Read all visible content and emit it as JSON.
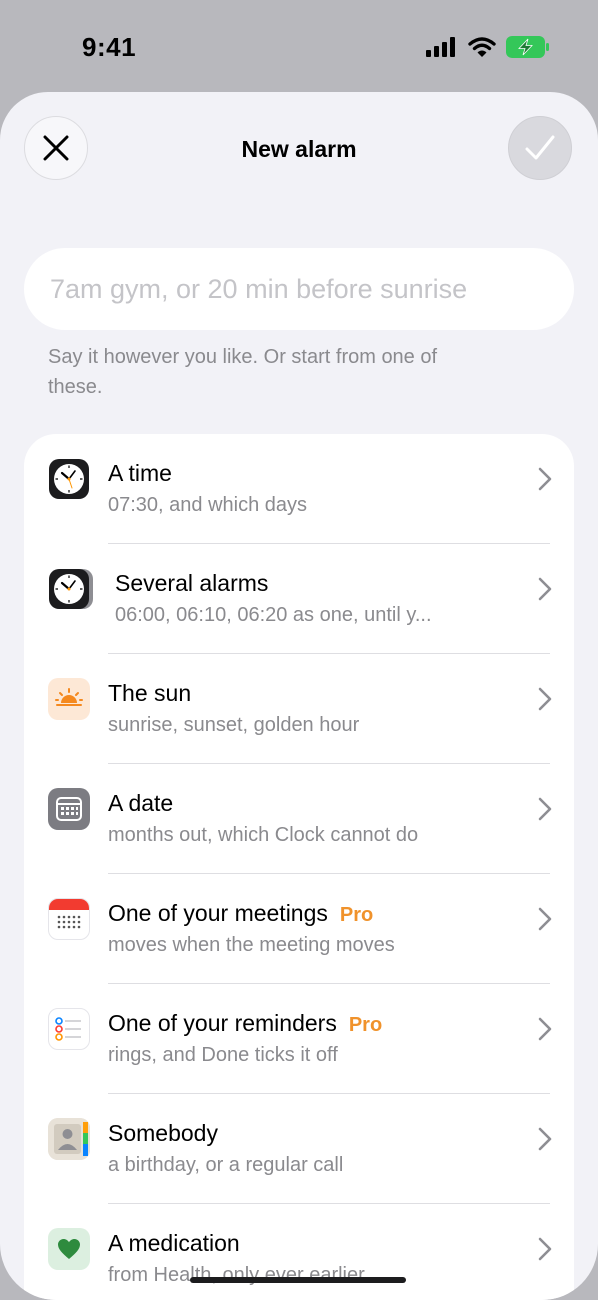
{
  "status_bar": {
    "time": "9:41"
  },
  "header": {
    "title": "New alarm"
  },
  "search": {
    "placeholder": "7am gym, or 20 min before sunrise",
    "value": ""
  },
  "hint": "Say it however you like. Or start from one of these.",
  "options": [
    {
      "icon": "clock-icon",
      "label": "A time",
      "sub": "07:30, and which days",
      "pro": ""
    },
    {
      "icon": "stacked-clocks-icon",
      "label": "Several alarms",
      "sub": "06:00, 06:10, 06:20 as one, until y...",
      "pro": ""
    },
    {
      "icon": "sunrise-icon",
      "label": "The sun",
      "sub": "sunrise, sunset, golden hour",
      "pro": ""
    },
    {
      "icon": "calendar-grid-icon",
      "label": "A date",
      "sub": "months out, which Clock cannot do",
      "pro": ""
    },
    {
      "icon": "calendar-app-icon",
      "label": "One of your meetings",
      "sub": "moves when the meeting moves",
      "pro": "Pro"
    },
    {
      "icon": "reminders-app-icon",
      "label": "One of your reminders",
      "sub": "rings, and Done ticks it off",
      "pro": "Pro"
    },
    {
      "icon": "contacts-app-icon",
      "label": "Somebody",
      "sub": "a birthday, or a regular call",
      "pro": ""
    },
    {
      "icon": "heart-icon",
      "label": "A medication",
      "sub": "from Health, only ever earlier",
      "pro": ""
    }
  ],
  "colors": {
    "pro_accent": "#f0922b",
    "battery": "#34c759",
    "sunrise": "#f5891f",
    "health_green": "#2e8b3e"
  }
}
